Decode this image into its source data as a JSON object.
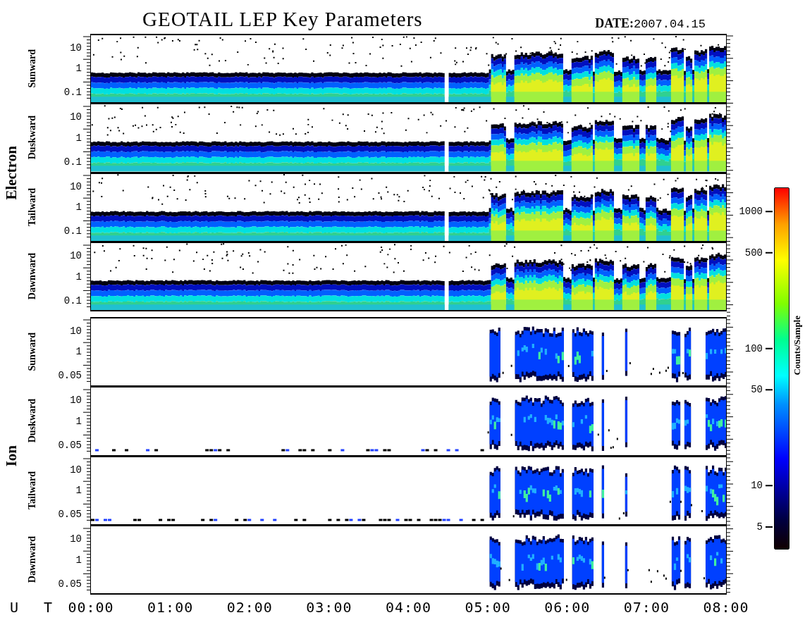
{
  "title": "GEOTAIL LEP Key Parameters",
  "date_label": "DATE:",
  "date": "2007.04.15",
  "groups": [
    {
      "species": "Electron",
      "panels": [
        {
          "direction": "Sunward",
          "yticks": [
            "10",
            "1",
            "0.1"
          ]
        },
        {
          "direction": "Duskward",
          "yticks": [
            "10",
            "1",
            "0.1"
          ]
        },
        {
          "direction": "Tailward",
          "yticks": [
            "10",
            "1",
            "0.1"
          ]
        },
        {
          "direction": "Dawnward",
          "yticks": [
            "10",
            "1",
            "0.1"
          ]
        }
      ]
    },
    {
      "species": "Ion",
      "panels": [
        {
          "direction": "Sunward",
          "yticks": [
            "10",
            "1",
            "0.05"
          ]
        },
        {
          "direction": "Duskward",
          "yticks": [
            "10",
            "1",
            "0.05"
          ]
        },
        {
          "direction": "Tailward",
          "yticks": [
            "10",
            "1",
            "0.05"
          ]
        },
        {
          "direction": "Dawnward",
          "yticks": [
            "10",
            "1",
            "0.05"
          ]
        }
      ]
    }
  ],
  "time_axis": {
    "label": "U T",
    "ticks": [
      "00:00",
      "01:00",
      "02:00",
      "03:00",
      "04:00",
      "05:00",
      "06:00",
      "07:00",
      "08:00"
    ]
  },
  "colorbar": {
    "title": "Counts/Sample",
    "ticks": [
      "1000",
      "500",
      "100",
      "50",
      "10",
      "5"
    ]
  }
}
